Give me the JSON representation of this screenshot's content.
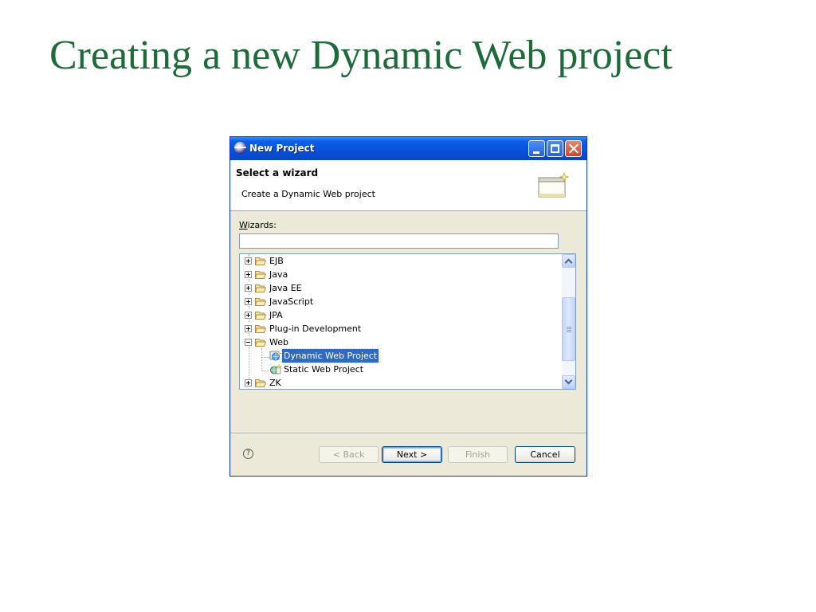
{
  "slide": {
    "title": "Creating a new Dynamic Web project"
  },
  "window": {
    "title": "New Project",
    "controls": [
      "minimize-icon",
      "maximize-icon",
      "close-icon"
    ]
  },
  "banner": {
    "title": "Select a wizard",
    "description": "Create a Dynamic Web project",
    "icon": "wizard-banner-icon"
  },
  "wizards": {
    "label_mnemonic": "W",
    "label_rest": "izards:",
    "filter_value": ""
  },
  "tree": {
    "items": [
      {
        "label": "EJB",
        "expanded": false,
        "icon": "folder-icon"
      },
      {
        "label": "Java",
        "expanded": false,
        "icon": "folder-icon"
      },
      {
        "label": "Java EE",
        "expanded": false,
        "icon": "folder-icon"
      },
      {
        "label": "JavaScript",
        "expanded": false,
        "icon": "folder-icon"
      },
      {
        "label": "JPA",
        "expanded": false,
        "icon": "folder-icon"
      },
      {
        "label": "Plug-in Development",
        "expanded": false,
        "icon": "folder-icon"
      },
      {
        "label": "Web",
        "expanded": true,
        "icon": "folder-open-icon",
        "children": [
          {
            "label": "Dynamic Web Project",
            "selected": true,
            "icon": "dynamic-web-project-icon"
          },
          {
            "label": "Static Web Project",
            "selected": false,
            "icon": "static-web-project-icon"
          }
        ]
      },
      {
        "label": "ZK",
        "expanded": false,
        "icon": "folder-icon"
      }
    ]
  },
  "buttons": {
    "help": "?",
    "back": "< Back",
    "next": "Next >",
    "finish": "Finish",
    "cancel": "Cancel"
  },
  "colors": {
    "title_green": "#1e6b3a",
    "titlebar_blue": "#0550d8",
    "selection_blue": "#316ac5",
    "dialog_bg": "#ece9d8"
  }
}
